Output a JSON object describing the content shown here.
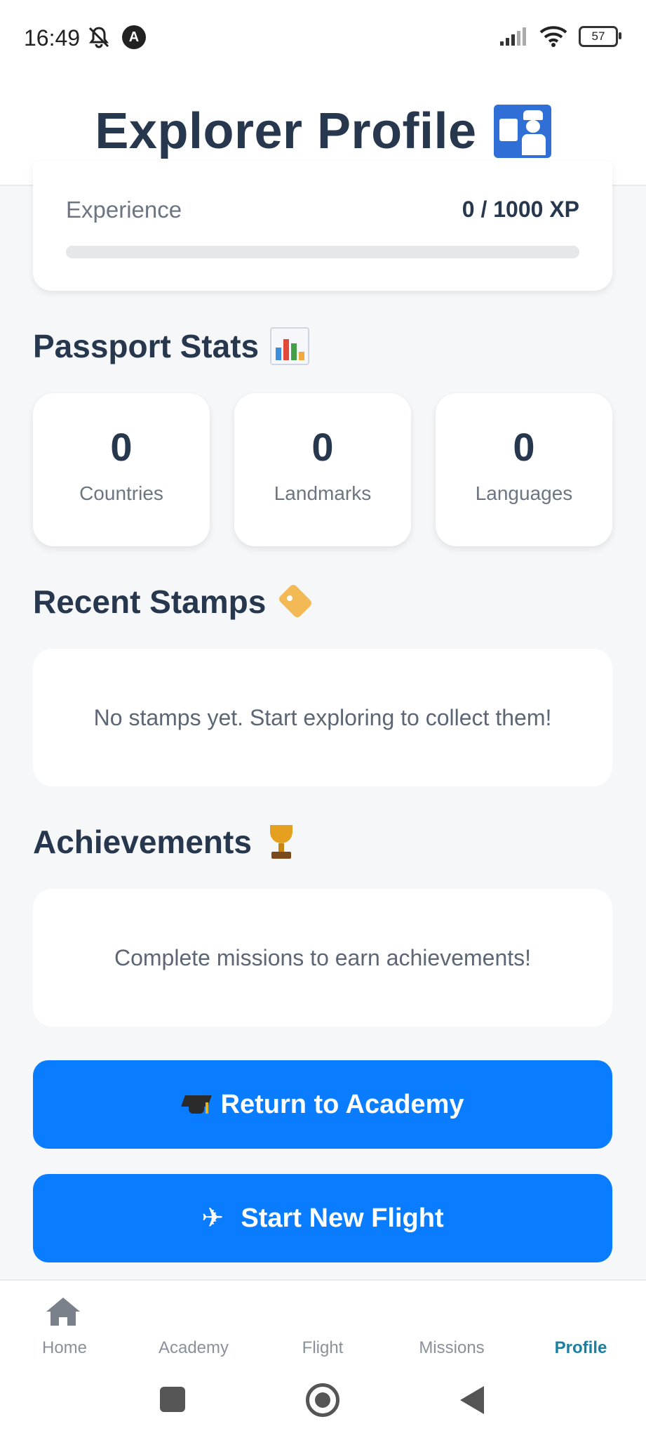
{
  "status_bar": {
    "time": "16:49",
    "battery": "57"
  },
  "header": {
    "title": "Explorer Profile"
  },
  "xp": {
    "label": "Experience",
    "value": "0 / 1000 XP",
    "progress_fraction": 0
  },
  "passport_stats": {
    "title": "Passport Stats",
    "items": [
      {
        "value": "0",
        "label": "Countries"
      },
      {
        "value": "0",
        "label": "Landmarks"
      },
      {
        "value": "0",
        "label": "Languages"
      }
    ]
  },
  "recent_stamps": {
    "title": "Recent Stamps",
    "empty_text": "No stamps yet. Start exploring to collect them!"
  },
  "achievements": {
    "title": "Achievements",
    "empty_text": "Complete missions to earn achievements!"
  },
  "buttons": {
    "return_label": "Return to Academy",
    "flight_label": "Start New Flight"
  },
  "bottom_nav": {
    "items": [
      {
        "label": "Home"
      },
      {
        "label": "Academy"
      },
      {
        "label": "Flight"
      },
      {
        "label": "Missions"
      },
      {
        "label": "Profile"
      }
    ],
    "active": "Profile"
  },
  "colors": {
    "primary": "#0a7cff",
    "active_nav": "#1a7fa0",
    "title_text": "#27374d"
  }
}
